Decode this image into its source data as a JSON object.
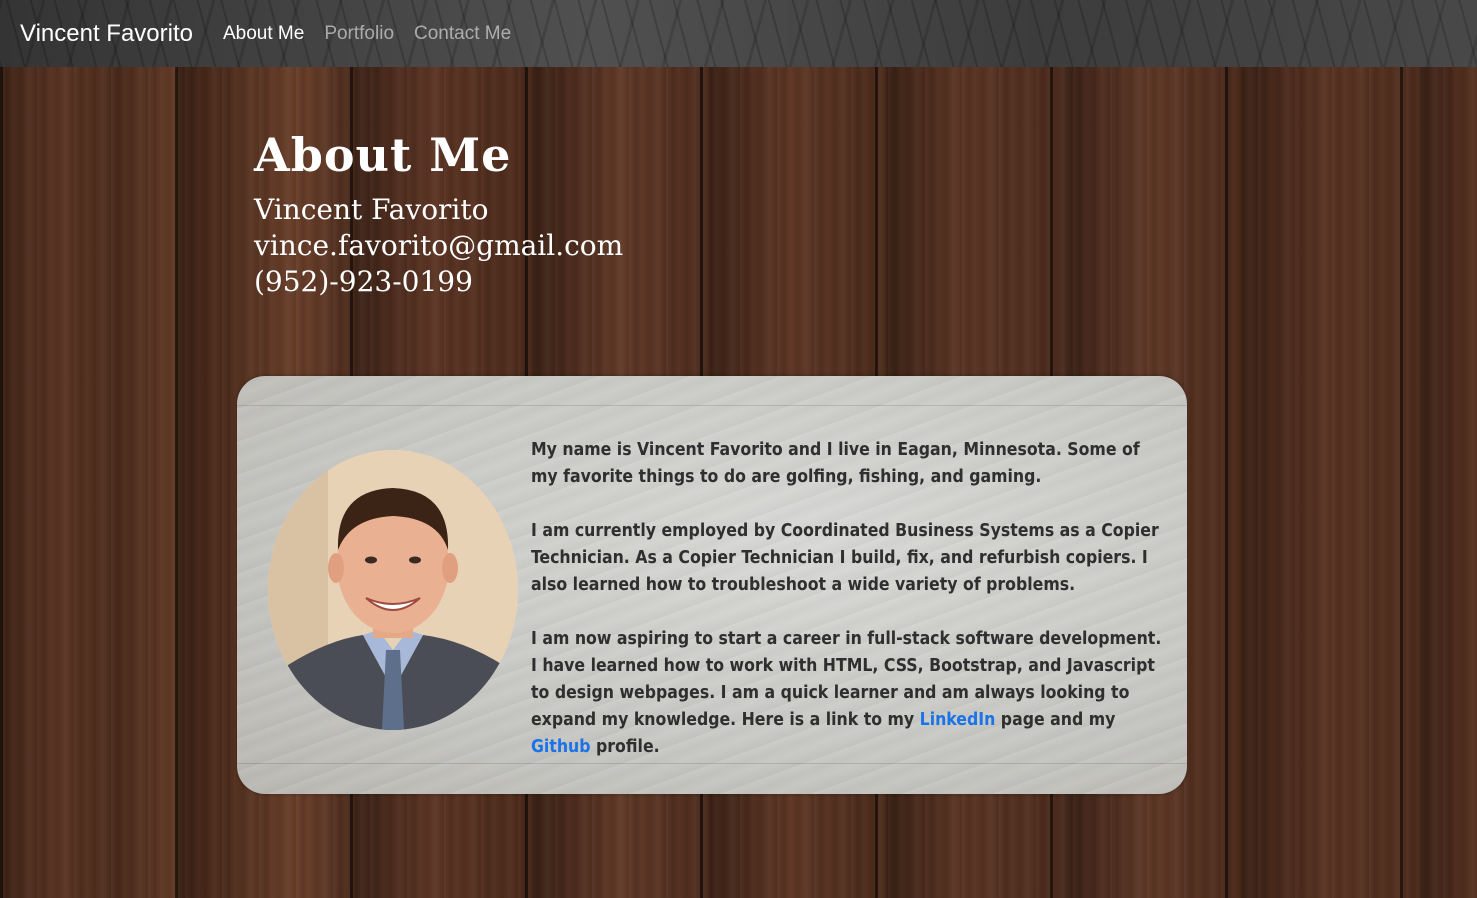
{
  "nav": {
    "brand": "Vincent Favorito",
    "links": [
      {
        "label": "About Me",
        "active": true
      },
      {
        "label": "Portfolio",
        "active": false
      },
      {
        "label": "Contact Me",
        "active": false
      }
    ]
  },
  "header": {
    "title": "About Me",
    "name": "Vincent Favorito",
    "email": "vince.favorito@gmail.com",
    "phone": "(952)-923-0199"
  },
  "bio": {
    "paragraph1": "My name is Vincent Favorito and I live in Eagan, Minnesota. Some of my favorite things to do are golfing, fishing, and gaming.",
    "paragraph2": "I am currently employed by Coordinated Business Systems as a Copier Technician. As a Copier Technician I build, fix, and refurbish copiers. I also learned how to troubleshoot a wide variety of problems.",
    "paragraph3_start": "I am now aspiring to start a career in full-stack software development. I have learned how to work with HTML, CSS, Bootstrap, and Javascript to design webpages. I am a quick learner and am always looking to expand my knowledge. Here is a link to my ",
    "linkedin_label": "LinkedIn",
    "paragraph3_mid": " page and my ",
    "github_label": "Github",
    "paragraph3_end": " profile."
  },
  "colors": {
    "link": "#1a73e8",
    "nav_active": "#ffffff",
    "nav_inactive": "rgba(255,255,255,0.55)",
    "bio_text": "#2f2f2f"
  }
}
